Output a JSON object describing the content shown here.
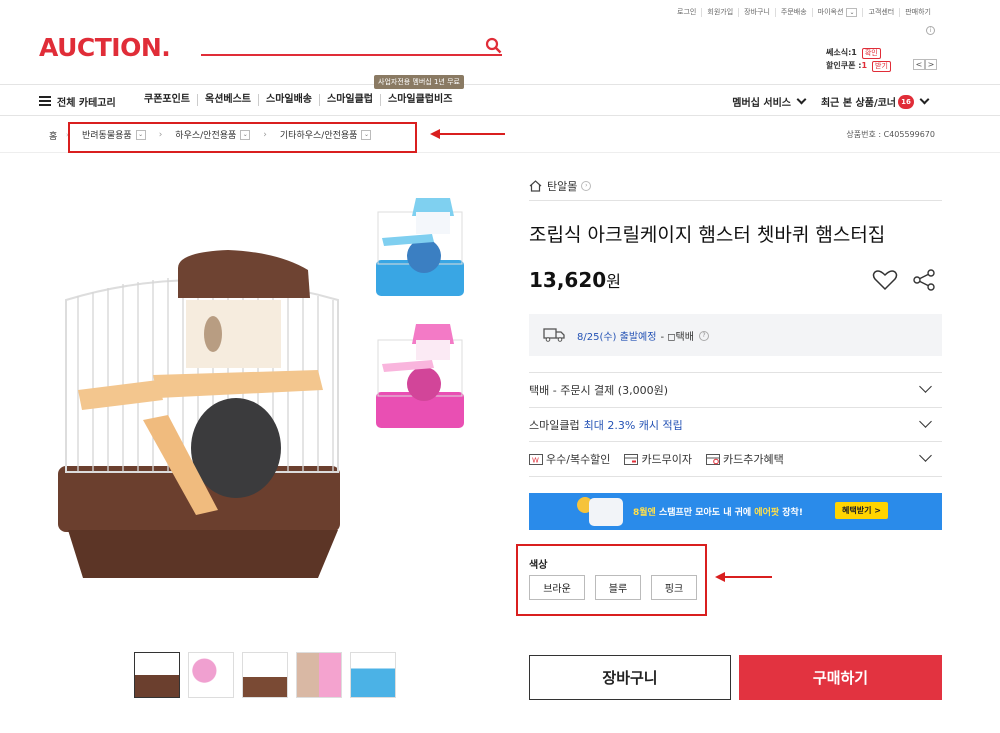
{
  "util_links": [
    "로그인",
    "회원가입",
    "장바구니",
    "주문배송",
    "마이옥션",
    "고객센터",
    "판매하기"
  ],
  "logo": "AUCTION.",
  "header_mini": {
    "coupon_label": "쎄소식:1",
    "coupon_btn": "확인",
    "discount_label": "할인쿠폰 :",
    "discount_count": "1",
    "discount_btn": "받기",
    "prev": "<",
    "next": ">"
  },
  "nav": {
    "all_category": "전체 카테고리",
    "items": [
      "쿠폰포인트",
      "옥션베스트",
      "스마일배송",
      "스마일클럽",
      "스마일클럽비즈"
    ],
    "tooltip": "사업자전용 멤버십 1년 무료",
    "membership": "멤버십 서비스",
    "recent": "최근 본 상품/코너",
    "recent_count": "16"
  },
  "breadcrumb": {
    "home": "홈",
    "levels": [
      "반려동물용품",
      "하우스/안전용품",
      "기타하우스/안전용품"
    ],
    "product_code": "상품번호 : C405599670"
  },
  "product": {
    "store": "탄알몰",
    "title": "조립식 아크릴케이지 햄스터 쳇바퀴 햄스터집",
    "price": "13,620",
    "currency": "원",
    "shipping_date": "8/25(수) 출발예정",
    "shipping_type": "- ◻택배",
    "delivery": "택배 - 주문시 결제 (3,000원)",
    "smileclub_prefix": "스마일클럽",
    "smileclub_highlight": "최대 2.3% 캐시 적립",
    "benefits": [
      "우수/복수할인",
      "카드무이자",
      "카드추가혜택"
    ],
    "banner_text_a": "8월엔",
    "banner_text_b": " 스탬프만 모아도 내 귀에 ",
    "banner_text_c": "에어팟",
    "banner_text_d": " 장착!",
    "banner_btn": "혜택받기 >",
    "option_label": "색상",
    "options": [
      "브라운",
      "블루",
      "핑크"
    ],
    "cart_btn": "장바구니",
    "buy_btn": "구매하기"
  },
  "colors": {
    "brand": "#e02d38",
    "highlight_box": "#d91f1f",
    "buy": "#e23340",
    "link": "#2553b5",
    "banner": "#2a8bea"
  }
}
